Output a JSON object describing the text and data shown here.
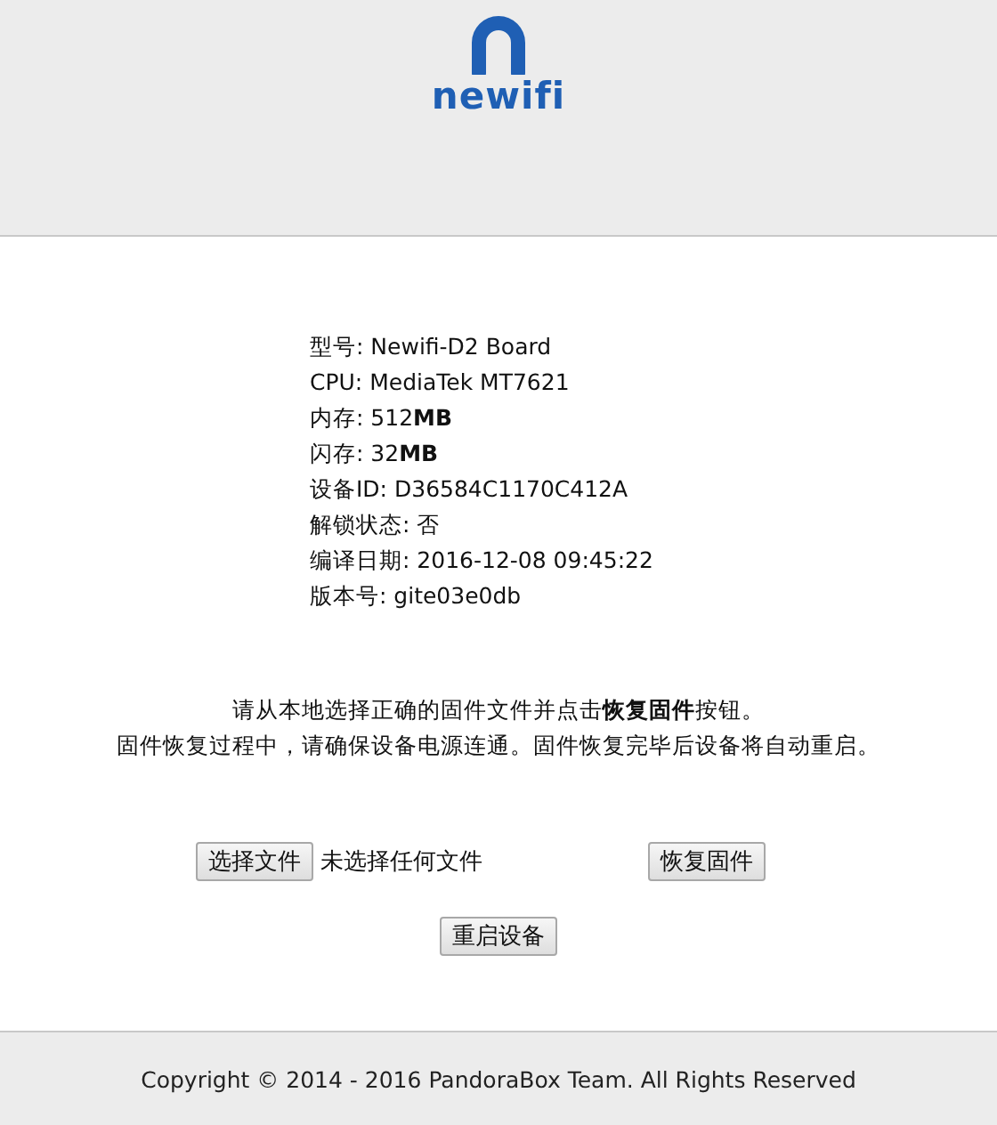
{
  "logo": {
    "text": "newifi"
  },
  "info": [
    {
      "label": "型号:",
      "value": "Newifi-D2 Board"
    },
    {
      "label": "CPU:",
      "value": "MediaTek MT7621"
    },
    {
      "label": "内存:",
      "value": "512**MB**"
    },
    {
      "label": "闪存:",
      "value": "32**MB**"
    },
    {
      "label": "设备ID:",
      "value": "D36584C1170C412A"
    },
    {
      "label": "解锁状态:",
      "value": "否"
    },
    {
      "label": "编译日期:",
      "value": "2016-12-08 09:45:22"
    },
    {
      "label": "版本号:",
      "value": "gite03e0db"
    }
  ],
  "notice": [
    "请从本地选择正确的固件文件并点击**恢复固件**按钮。",
    "固件恢复过程中，请确保设备电源连通。固件恢复完毕后设备将自动重启。"
  ],
  "file_input": {
    "button": "选择文件",
    "status": "未选择任何文件"
  },
  "restore_button": "恢复固件",
  "reboot_button": "重启设备",
  "footer": "Copyright © 2014 - 2016 PandoraBox Team. All Rights Reserved"
}
